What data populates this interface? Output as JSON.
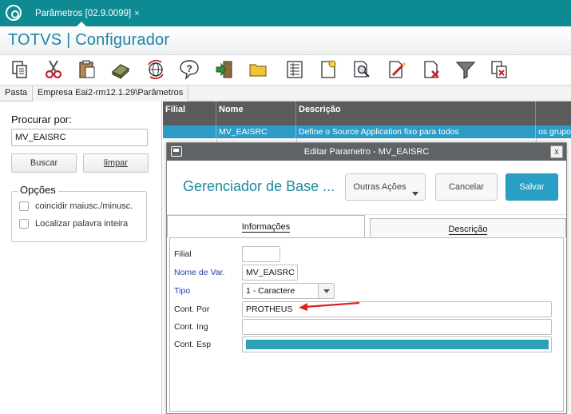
{
  "tabbar": {
    "tab_label": "Parâmetros [02.9.0099]",
    "close_glyph": "×"
  },
  "app": {
    "title": "TOTVS | Configurador"
  },
  "toolbar": {
    "icons": [
      "copy-icon",
      "cut-icon",
      "paste-icon",
      "eraser-icon",
      "globe-icon",
      "help-icon",
      "exit-icon",
      "folder-icon",
      "list-icon",
      "new-document-icon",
      "preview-icon",
      "edit-icon",
      "delete-icon",
      "filter-icon",
      "paste-special-icon"
    ]
  },
  "pasta": {
    "label": "Pasta",
    "tab": "Empresa Eai2-rm12.1.29\\Parâmetros"
  },
  "search": {
    "title": "Procurar por:",
    "value": "MV_EAISRC",
    "buscar_label": "Buscar",
    "limpar_label": "limpar"
  },
  "options": {
    "title": "Opções",
    "items": [
      {
        "label": "coincidir maiusc./minusc."
      },
      {
        "label": "Localizar palavra inteira"
      }
    ]
  },
  "grid": {
    "columns": [
      "Filial",
      "Nome",
      "Descrição",
      ""
    ],
    "selected_row": [
      "",
      "MV_EAISRC",
      "Define o Source Application fixo para todos",
      "os grupos"
    ]
  },
  "modal": {
    "window_title": "Editar Parametro - MV_EAISRC",
    "close_glyph": "x",
    "header_title": "Gerenciador de Base ...",
    "outras_acoes": "Outras Ações",
    "cancelar": "Cancelar",
    "salvar": "Salvar",
    "tab_info": "Informações",
    "tab_desc": "Descrição",
    "fields": {
      "filial_label": "Filial",
      "filial_value": "",
      "nome_label": "Nome de Var.",
      "nome_value": "MV_EAISRC",
      "tipo_label": "Tipo",
      "tipo_value": "1 - Caractere",
      "cont_por_label": "Cont. Por",
      "cont_por_value": "PROTHEUS",
      "cont_ing_label": "Cont. Ing",
      "cont_ing_value": "",
      "cont_esp_label": "Cont. Esp",
      "cont_esp_value": ""
    }
  },
  "colors": {
    "teal_bar": "#0e8a93",
    "title_blue": "#1f84a8",
    "selected_row": "#2d9cc7",
    "save_button": "#2a9fc6",
    "annotation_arrow": "#e02020"
  }
}
